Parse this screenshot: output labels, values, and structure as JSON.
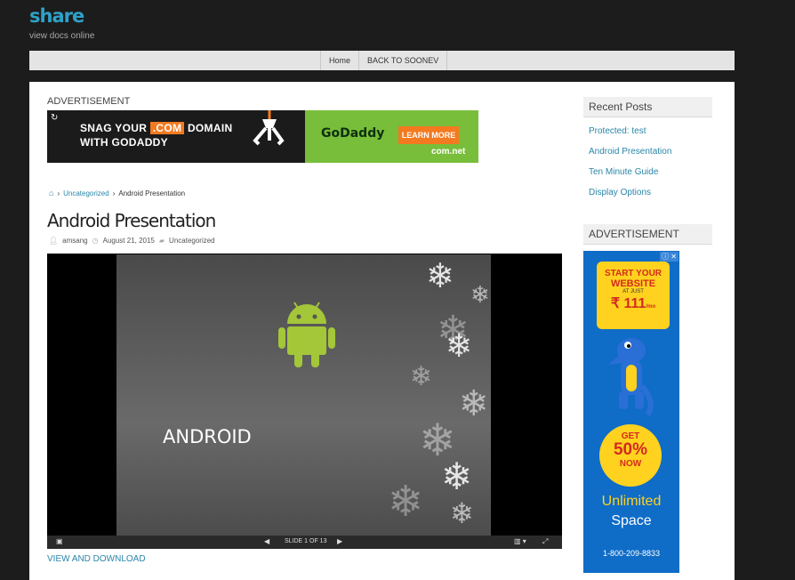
{
  "site": {
    "title": "share",
    "description": "view docs online"
  },
  "nav": {
    "items": [
      {
        "label": "Home"
      },
      {
        "label": "BACK TO SOONEV"
      }
    ]
  },
  "main_ad": {
    "label": "ADVERTISEMENT",
    "headline_pre": "SNAG YOUR ",
    "headline_com": ".COM",
    "headline_post": " DOMAIN",
    "headline_line2": "WITH GODADDY",
    "brand": "GoDaddy",
    "cta": "LEARN MORE",
    "footer_brand": "com.net"
  },
  "breadcrumb": {
    "items": [
      "Uncategorized",
      "Android Presentation"
    ]
  },
  "post": {
    "title": "Android Presentation",
    "author": "amsang",
    "date": "August 21, 2015",
    "category": "Uncategorized"
  },
  "viewer": {
    "slide_text": "ANDROID",
    "slide_counter": "SLIDE 1 OF 13",
    "view_download": "VIEW AND DOWNLOAD"
  },
  "sidebar": {
    "recent_title": "Recent Posts",
    "recent_posts": [
      "Protected: test",
      "Android Presentation",
      "Ten Minute Guide",
      "Display Options"
    ],
    "ad_title": "ADVERTISEMENT",
    "ad": {
      "line1": "START YOUR",
      "line2": "WEBSITE",
      "line3": "AT JUST",
      "price": "₹ 111",
      "price_unit": "/mo",
      "get": "GET",
      "percent": "50%",
      "now": "NOW",
      "unlimited": "Unlimited",
      "space": "Space",
      "phone": "1-800-209-8833"
    }
  },
  "colors": {
    "link": "#2a86a8",
    "title": "#2fa1c8",
    "android_green": "#a4c639"
  }
}
